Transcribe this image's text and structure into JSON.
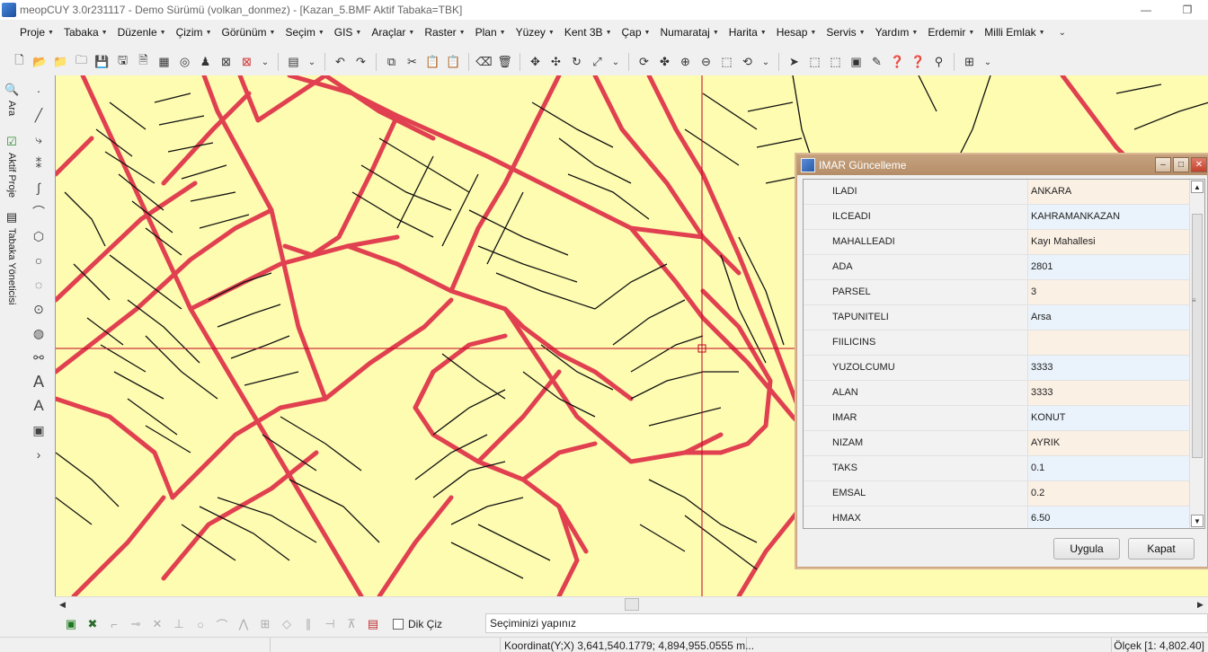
{
  "window": {
    "title": "meopCUY 3.0r231117 - Demo Sürümü (volkan_donmez)  - [Kazan_5.BMF  Aktif Tabaka=TBK]",
    "minimize": "—",
    "restore": "❐"
  },
  "menu": [
    {
      "label": "Proje"
    },
    {
      "label": "Tabaka"
    },
    {
      "label": "Düzenle"
    },
    {
      "label": "Çizim"
    },
    {
      "label": "Görünüm"
    },
    {
      "label": "Seçim"
    },
    {
      "label": "GIS"
    },
    {
      "label": "Araçlar"
    },
    {
      "label": "Raster"
    },
    {
      "label": "Plan"
    },
    {
      "label": "Yüzey"
    },
    {
      "label": "Kent 3B"
    },
    {
      "label": "Çap"
    },
    {
      "label": "Numarataj"
    },
    {
      "label": "Harita"
    },
    {
      "label": "Hesap"
    },
    {
      "label": "Servis"
    },
    {
      "label": "Yardım"
    },
    {
      "label": "Erdemir"
    },
    {
      "label": "Milli Emlak"
    }
  ],
  "left_tabs": {
    "search": "Ara",
    "project": "Aktif Proje",
    "layers": "Tabaka Yöneticisi"
  },
  "bottom": {
    "dik_ciz_label": "Dik Çiz",
    "command_prompt": "Seçiminizi yapınız"
  },
  "status": {
    "coordinate": "Koordinat(Y;X)  3,641,540.1779; 4,894,955.0555 m...",
    "scale": "Ölçek [1: 4,802.40]"
  },
  "dialog": {
    "title": "IMAR Güncelleme",
    "apply_label": "Uygula",
    "close_label": "Kapat",
    "fields": [
      {
        "name": "ILADI",
        "value": "ANKARA"
      },
      {
        "name": "ILCEADI",
        "value": "KAHRAMANKAZAN"
      },
      {
        "name": "MAHALLEADI",
        "value": "Kayı Mahallesi"
      },
      {
        "name": "ADA",
        "value": "2801"
      },
      {
        "name": "PARSEL",
        "value": "3"
      },
      {
        "name": "TAPUNITELI",
        "value": "Arsa"
      },
      {
        "name": "FIILICINS",
        "value": ""
      },
      {
        "name": "YUZOLCUMU",
        "value": "3333"
      },
      {
        "name": "ALAN",
        "value": "3333"
      },
      {
        "name": "IMAR",
        "value": "KONUT"
      },
      {
        "name": "NIZAM",
        "value": "AYRIK"
      },
      {
        "name": "TAKS",
        "value": "0.1"
      },
      {
        "name": "EMSAL",
        "value": "0.2"
      },
      {
        "name": "HMAX",
        "value": "6.50"
      }
    ]
  },
  "colors": {
    "map_fill": "#fefcb0",
    "road": "#e04050",
    "parcel_line": "#111111",
    "dialog_frame": "#c5a17d"
  }
}
